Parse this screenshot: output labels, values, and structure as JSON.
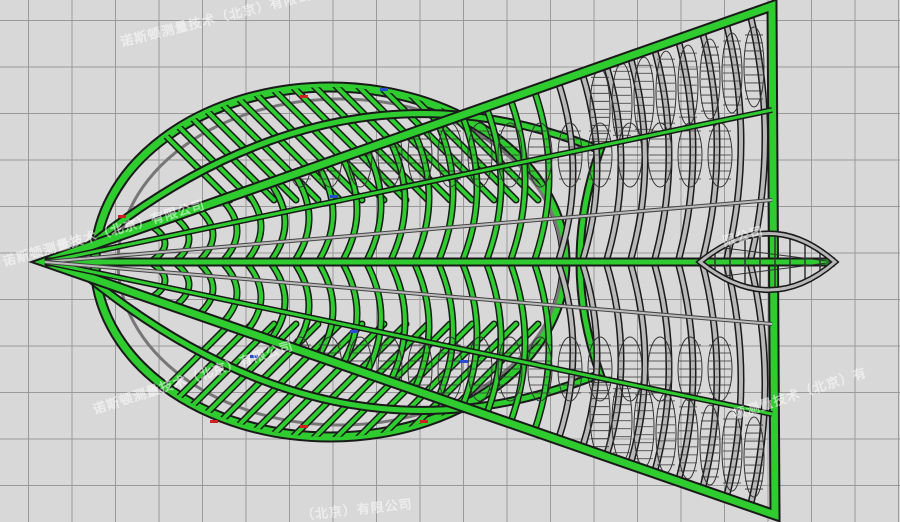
{
  "watermarks": {
    "w1": "诺斯顿测量技术（北京）有限公司",
    "w2": "诺斯顿测量技术（北京）有限公司",
    "w3": "诺斯顿测量技术（北京）有限公司",
    "w4": "限公司",
    "w5": "顿测量技术（北京）有",
    "w6": "（北京）有限公司"
  },
  "colors": {
    "background": "#d8d8d8",
    "grid": "#9a9a9a",
    "member_primary": "#2ecc2e",
    "member_outline": "#1a1a1a",
    "member_secondary": "#b8b8b8",
    "mesh": "#333333",
    "highlight_red": "#d22020",
    "highlight_blue": "#2a4ad0"
  },
  "icons": [
    "none"
  ]
}
